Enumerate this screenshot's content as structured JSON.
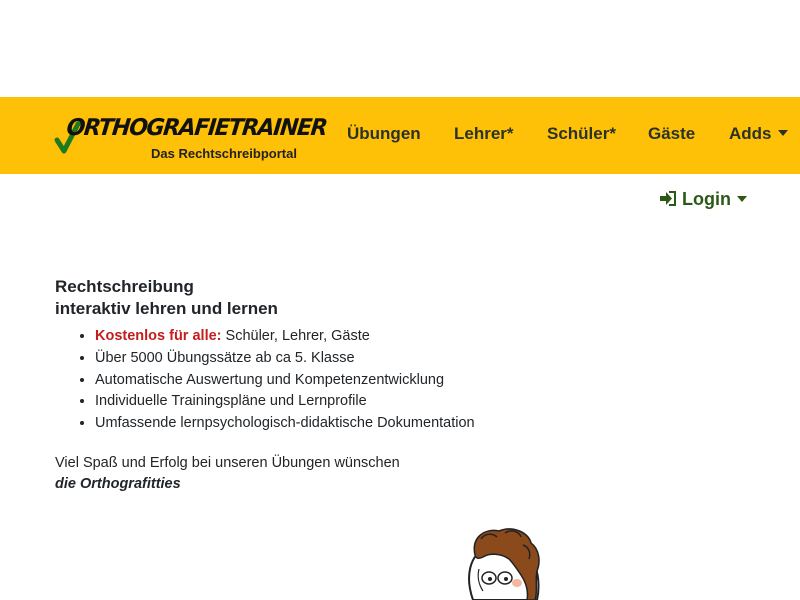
{
  "brand": {
    "title": "RTHOGRAFIETRAINER",
    "title_initial": "O",
    "subtitle": "Das Rechtschreibportal",
    "check_color": "#1e7a1e"
  },
  "nav": {
    "items": [
      {
        "label": "Übungen",
        "dropdown": false
      },
      {
        "label": "Lehrer*",
        "dropdown": false
      },
      {
        "label": "Schüler*",
        "dropdown": false
      },
      {
        "label": "Gäste",
        "dropdown": false
      },
      {
        "label": "Adds",
        "dropdown": true
      }
    ],
    "background": "#ffc107"
  },
  "login": {
    "label": "Login",
    "icon": "sign-in-icon",
    "color": "#2c5a16"
  },
  "intro": {
    "title_line1": "Rechtschreibung",
    "title_line2": "interaktiv lehren und lernen"
  },
  "features": [
    {
      "highlight": "Kostenlos für alle:",
      "text": " Schüler, Lehrer, Gäste"
    },
    {
      "highlight": "",
      "text": "Über 5000 Übungssätze ab ca 5. Klasse"
    },
    {
      "highlight": "",
      "text": "Automatische Auswertung und Kompetenzentwicklung"
    },
    {
      "highlight": "",
      "text": "Individuelle Trainingspläne und Lernprofile"
    },
    {
      "highlight": "",
      "text": "Umfassende lernpsychologisch-didaktische Dokumentation"
    }
  ],
  "greeting": {
    "line1": "Viel Spaß und Erfolg bei unseren Übungen wünschen",
    "signature": "die Orthografitties"
  },
  "colors": {
    "highlight_red": "#c31d1d",
    "text": "#212529"
  }
}
